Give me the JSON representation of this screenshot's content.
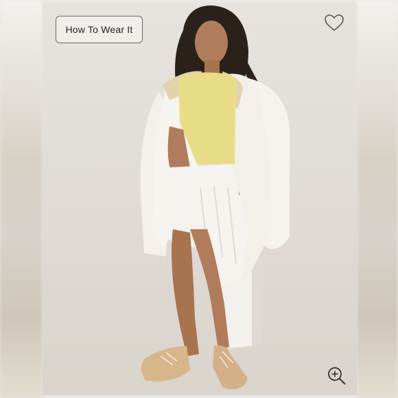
{
  "product_image": {
    "how_to_wear_label": "How To Wear It",
    "favorite_icon": "heart-outline-icon",
    "zoom_icon": "zoom-in-icon"
  },
  "colors": {
    "background": "#e9e7e3",
    "button_border": "#666666",
    "button_text": "#222222",
    "sweater": "#e8dc87",
    "jacket": "#f5f3ee",
    "shoes": "#d8b68c"
  }
}
